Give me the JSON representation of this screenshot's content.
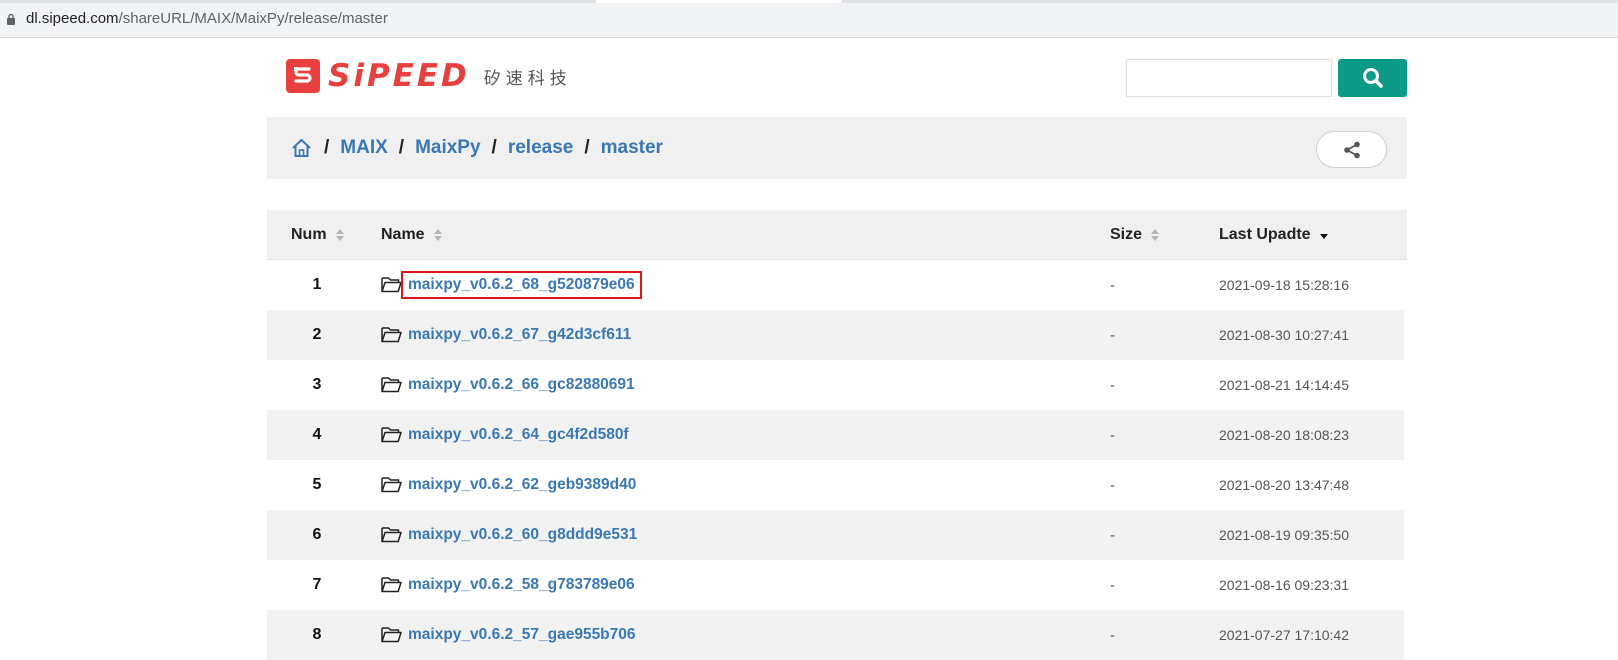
{
  "browser": {
    "url_host": "dl.sipeed.com",
    "url_path": "/shareURL/MAIX/MaixPy/release/master"
  },
  "header": {
    "logo_text": "SiPEED",
    "logo_cn": "矽速科技",
    "search_placeholder": ""
  },
  "breadcrumb": {
    "items": [
      "MAIX",
      "MaixPy",
      "release",
      "master"
    ],
    "separator": "/"
  },
  "table": {
    "columns": {
      "num": "Num",
      "name": "Name",
      "size": "Size",
      "last_update": "Last Upadte"
    },
    "rows": [
      {
        "num": "1",
        "name": "maixpy_v0.6.2_68_g520879e06",
        "size": "-",
        "date": "2021-09-18 15:28:16"
      },
      {
        "num": "2",
        "name": "maixpy_v0.6.2_67_g42d3cf611",
        "size": "-",
        "date": "2021-08-30 10:27:41"
      },
      {
        "num": "3",
        "name": "maixpy_v0.6.2_66_gc82880691",
        "size": "-",
        "date": "2021-08-21 14:14:45"
      },
      {
        "num": "4",
        "name": "maixpy_v0.6.2_64_gc4f2d580f",
        "size": "-",
        "date": "2021-08-20 18:08:23"
      },
      {
        "num": "5",
        "name": "maixpy_v0.6.2_62_geb9389d40",
        "size": "-",
        "date": "2021-08-20 13:47:48"
      },
      {
        "num": "6",
        "name": "maixpy_v0.6.2_60_g8ddd9e531",
        "size": "-",
        "date": "2021-08-19 09:35:50"
      },
      {
        "num": "7",
        "name": "maixpy_v0.6.2_58_g783789e06",
        "size": "-",
        "date": "2021-08-16 09:23:31"
      },
      {
        "num": "8",
        "name": "maixpy_v0.6.2_57_gae955b706",
        "size": "-",
        "date": "2021-07-27 17:10:42"
      }
    ]
  },
  "colors": {
    "brand_red": "#e8403f",
    "link_blue": "#3a78b5",
    "search_green": "#0d9a86",
    "highlight_red": "#e0141b"
  }
}
